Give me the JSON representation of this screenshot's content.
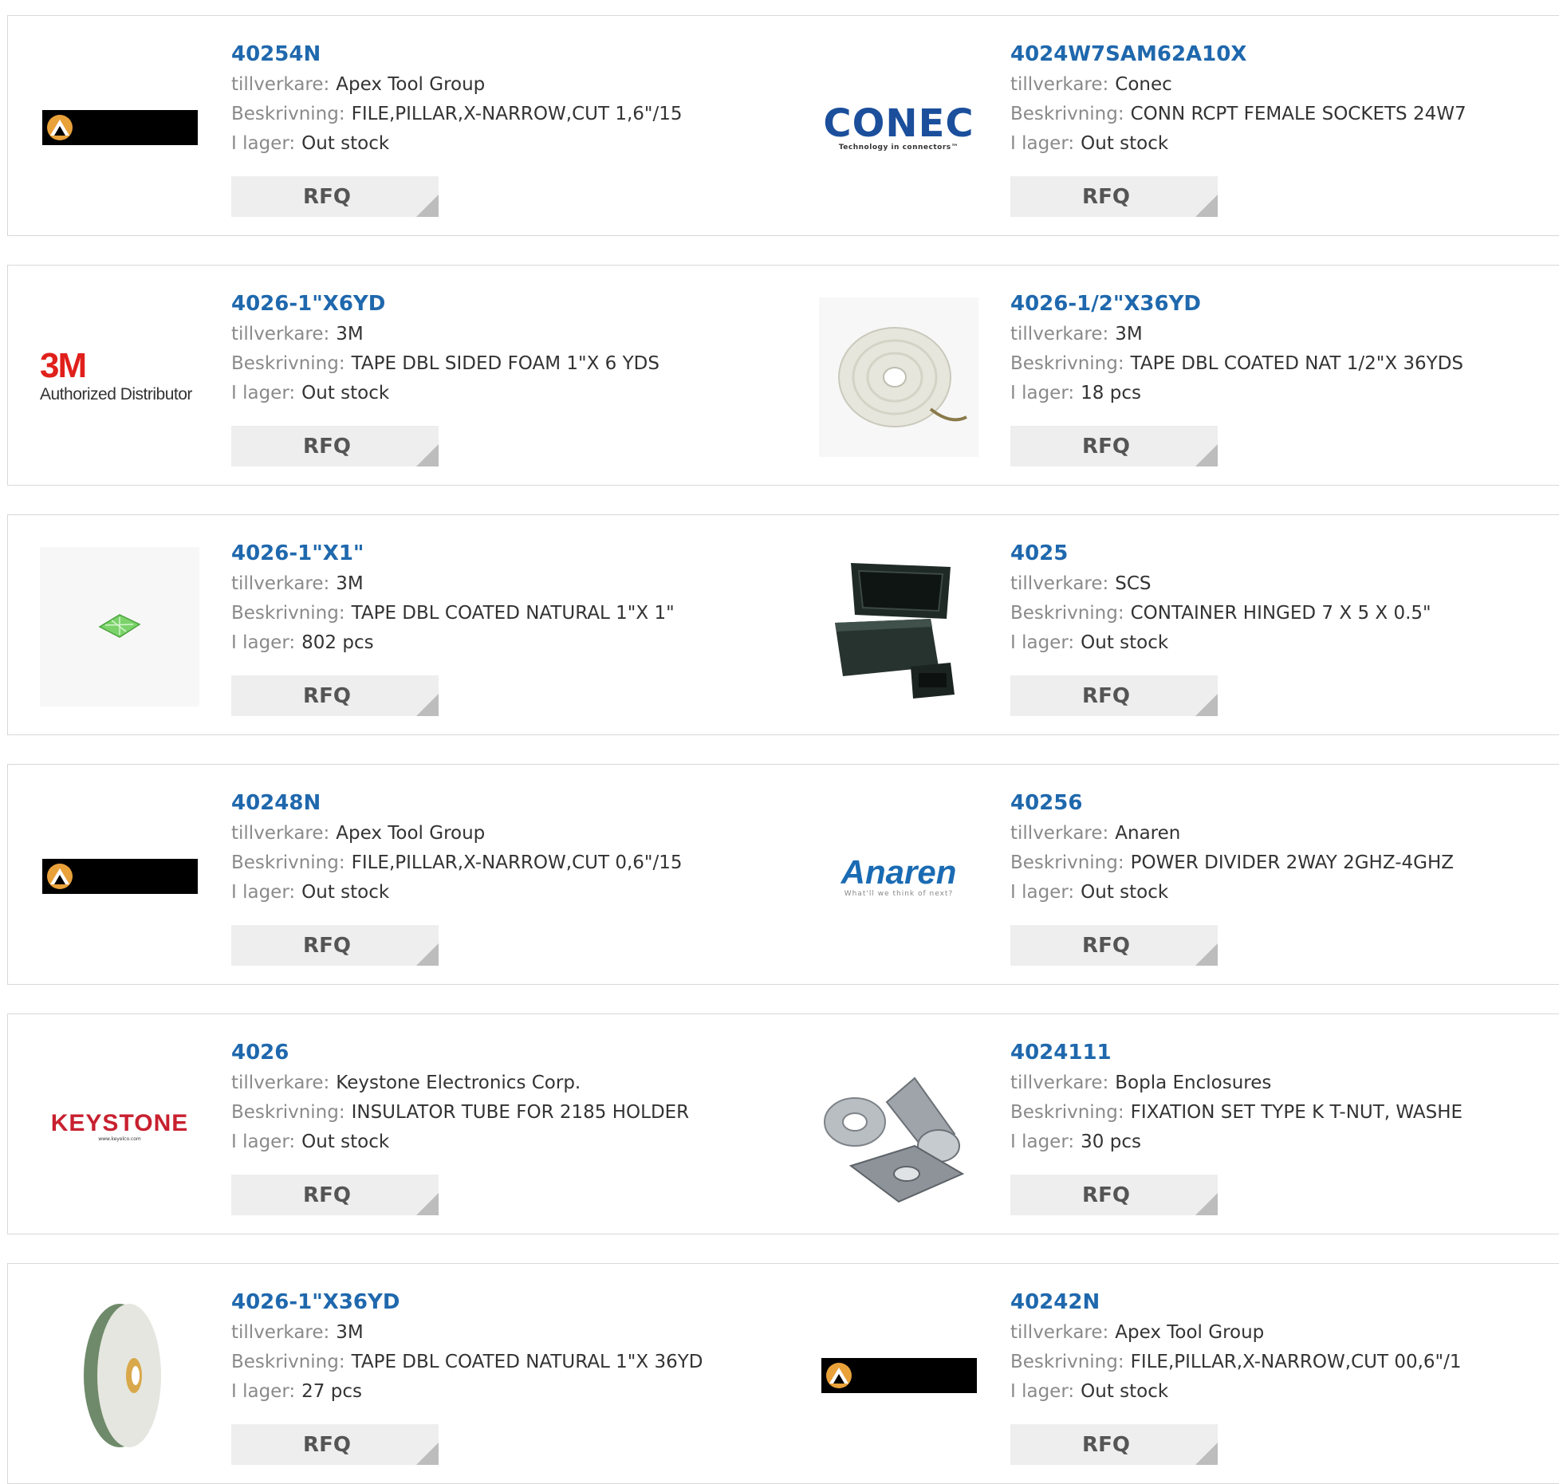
{
  "labels": {
    "manufacturer": "tillverkare:",
    "description": "Beskrivning:",
    "stock": "I lager:",
    "rfq": "RFQ"
  },
  "logos": {
    "conec": "CONEC",
    "conec_sub": "Technology in connectors™",
    "m3": "3M",
    "m3_sub": "Authorized Distributor",
    "anaren": "Anaren",
    "anaren_sub": "What'll we think of next?",
    "keystone": "KEYSTONE",
    "keystone_sub": "www.keyelco.com"
  },
  "products": [
    {
      "part": "40254N",
      "manufacturer": "Apex Tool Group",
      "description": "FILE,PILLAR,X-NARROW,CUT 1,6\"/15",
      "stock": "Out stock",
      "image": "apex-logo"
    },
    {
      "part": "4024W7SAM62A10X",
      "manufacturer": "Conec",
      "description": "CONN RCPT FEMALE SOCKETS 24W7",
      "stock": "Out stock",
      "image": "conec-logo"
    },
    {
      "part": "4026-1\"X6YD",
      "manufacturer": "3M",
      "description": "TAPE DBL SIDED FOAM 1\"X 6 YDS",
      "stock": "Out stock",
      "image": "3m-logo"
    },
    {
      "part": "4026-1/2\"X36YD",
      "manufacturer": "3M",
      "description": "TAPE DBL COATED NAT 1/2\"X 36YDS",
      "stock": "18 pcs",
      "image": "tape-roll-flat"
    },
    {
      "part": "4026-1\"X1\"",
      "manufacturer": "3M",
      "description": "TAPE DBL COATED NATURAL 1\"X 1\"",
      "stock": "802 pcs",
      "image": "tape-square"
    },
    {
      "part": "4025",
      "manufacturer": "SCS",
      "description": "CONTAINER HINGED 7 X 5 X 0.5\"",
      "stock": "Out stock",
      "image": "container-boxes"
    },
    {
      "part": "40248N",
      "manufacturer": "Apex Tool Group",
      "description": "FILE,PILLAR,X-NARROW,CUT 0,6\"/15",
      "stock": "Out stock",
      "image": "apex-logo"
    },
    {
      "part": "40256",
      "manufacturer": "Anaren",
      "description": "POWER DIVIDER 2WAY 2GHZ-4GHZ",
      "stock": "Out stock",
      "image": "anaren-logo"
    },
    {
      "part": "4026",
      "manufacturer": "Keystone Electronics Corp.",
      "description": "INSULATOR TUBE FOR 2185 HOLDER",
      "stock": "Out stock",
      "image": "keystone-logo"
    },
    {
      "part": "4024111",
      "manufacturer": "Bopla Enclosures",
      "description": "FIXATION SET TYPE K T-NUT, WASHE",
      "stock": "30 pcs",
      "image": "fixation-set"
    },
    {
      "part": "4026-1\"X36YD",
      "manufacturer": "3M",
      "description": "TAPE DBL COATED NATURAL 1\"X 36YD",
      "stock": "27 pcs",
      "image": "tape-roll-edge"
    },
    {
      "part": "40242N",
      "manufacturer": "Apex Tool Group",
      "description": "FILE,PILLAR,X-NARROW,CUT 00,6\"/1",
      "stock": "Out stock",
      "image": "apex-logo"
    }
  ],
  "colors": {
    "link": "#1f68ad",
    "label": "#8a8a8a",
    "value": "#333333",
    "border": "#d8d8d8",
    "button_bg": "#eeeeee",
    "button_text": "#555555"
  }
}
